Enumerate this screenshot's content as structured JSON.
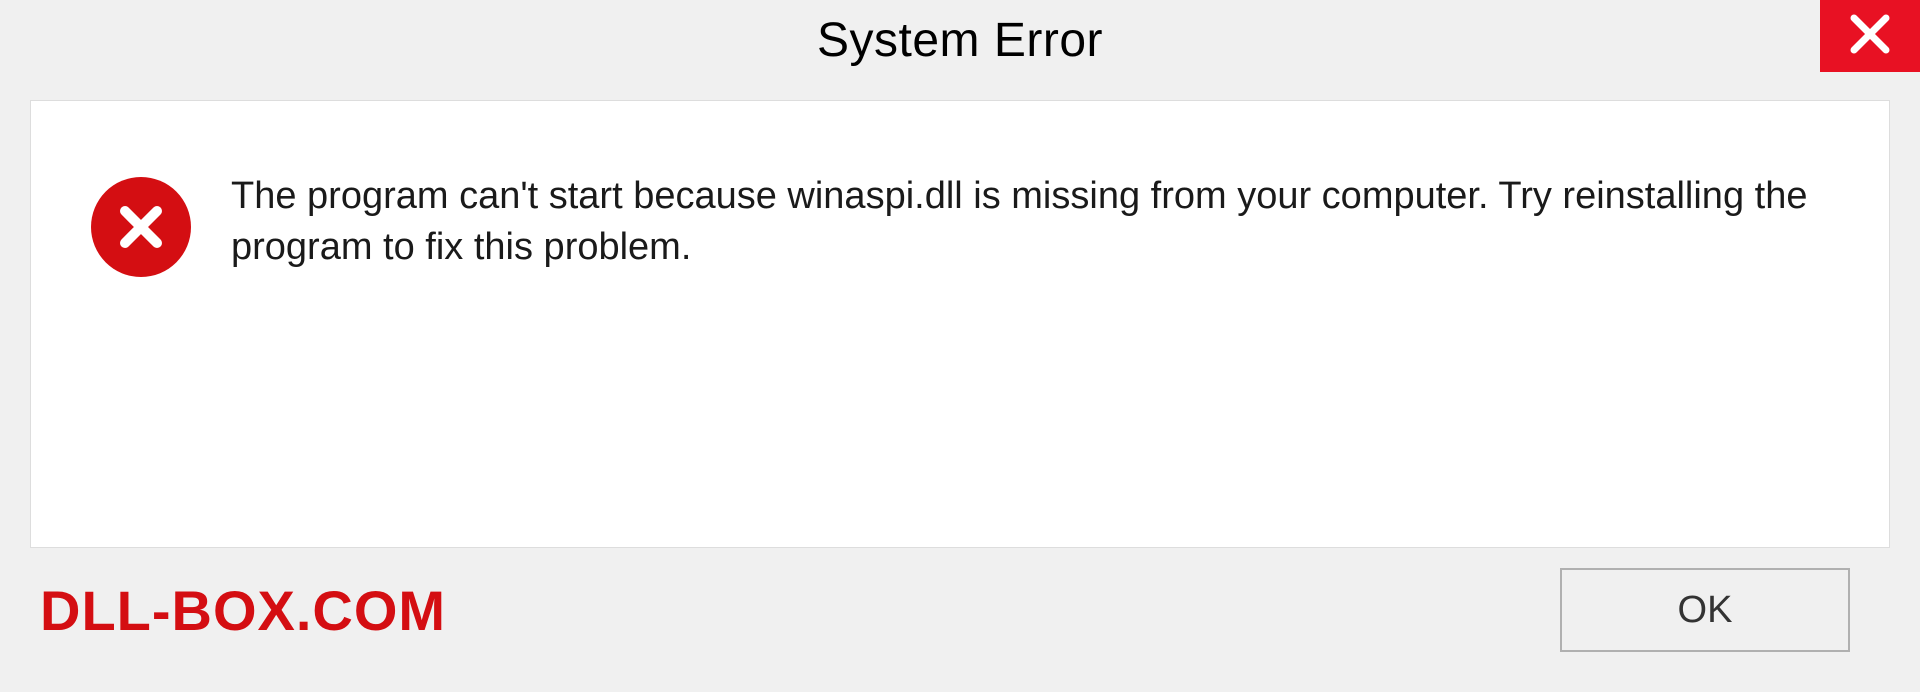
{
  "titlebar": {
    "title": "System Error"
  },
  "dialog": {
    "message": "The program can't start because winaspi.dll is missing from your computer. Try reinstalling the program to fix this problem."
  },
  "footer": {
    "watermark": "DLL-BOX.COM",
    "ok_label": "OK"
  },
  "colors": {
    "close_bg": "#e81123",
    "error_icon_bg": "#d40e12",
    "watermark_text": "#d40e12"
  }
}
